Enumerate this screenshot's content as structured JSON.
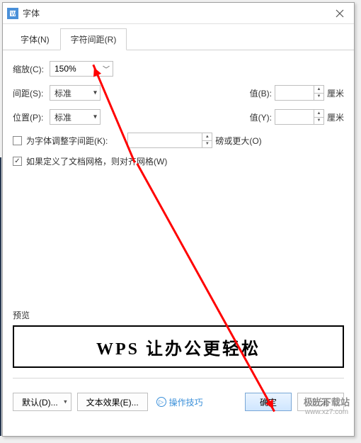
{
  "dialog": {
    "title": "字体"
  },
  "tabs": {
    "font": "字体(N)",
    "spacing": "字符间距(R)"
  },
  "scale": {
    "label": "缩放(C):",
    "value": "150%"
  },
  "spacing": {
    "label": "间距(S):",
    "value": "标准",
    "b_label": "值(B):",
    "b_value": "",
    "b_unit": "厘米"
  },
  "position": {
    "label": "位置(P):",
    "value": "标准",
    "y_label": "值(Y):",
    "y_value": "",
    "y_unit": "厘米"
  },
  "kerning": {
    "label": "为字体调整字间距(K):",
    "value": "",
    "unit": "磅或更大(O)"
  },
  "snapgrid": {
    "label": "如果定义了文档网格，则对齐网格(W)"
  },
  "preview": {
    "label": "预览",
    "text": "WPS 让办公更轻松"
  },
  "footer": {
    "default": "默认(D)...",
    "text_effect": "文本效果(E)...",
    "tip": "操作技巧",
    "ok": "确定",
    "cancel": "取消"
  },
  "watermark": {
    "main": "极光下载站",
    "sub": "www.xz7.com"
  }
}
